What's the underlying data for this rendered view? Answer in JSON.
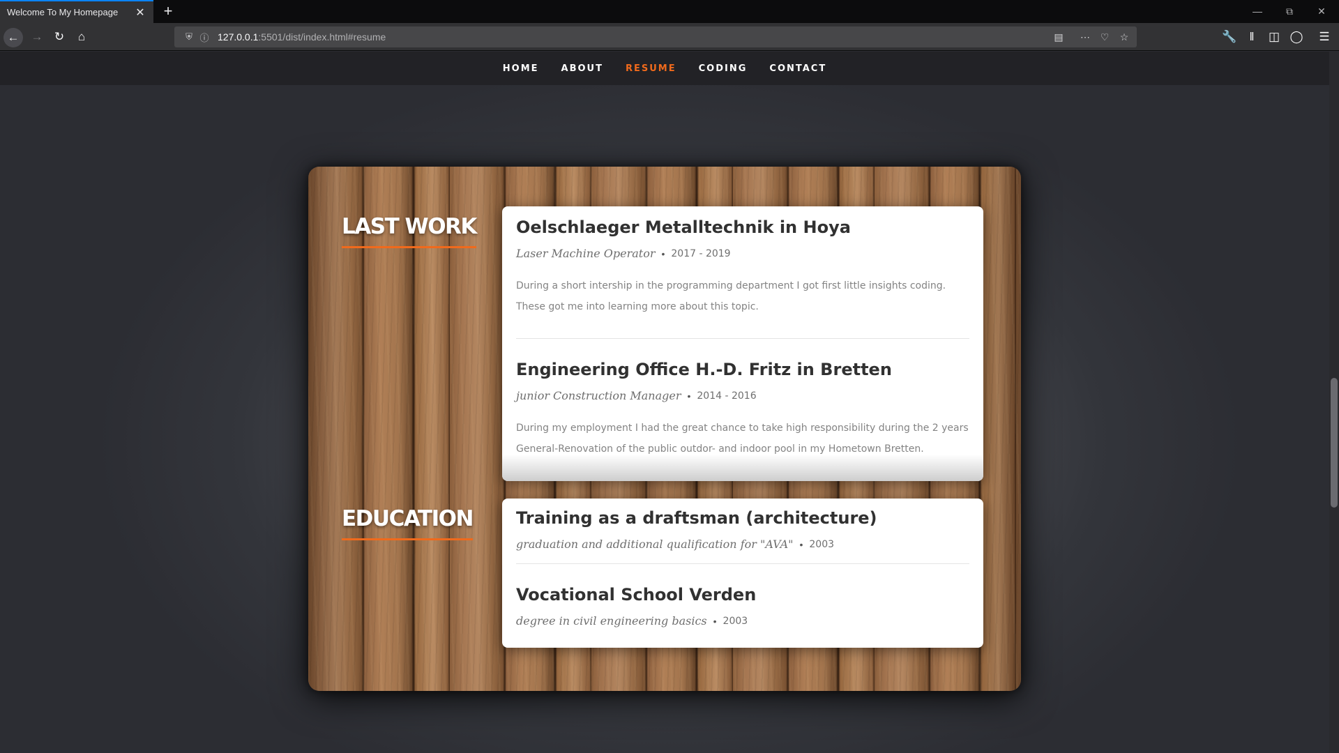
{
  "browser": {
    "tab_title": "Welcome To My Homepage",
    "tab_close": "✕",
    "new_tab": "+",
    "url_host": "127.0.0.1",
    "url_rest": ":5501/dist/index.html#resume"
  },
  "site_nav": {
    "items": [
      {
        "label": "HOME",
        "active": false
      },
      {
        "label": "ABOUT",
        "active": false
      },
      {
        "label": "RESUME",
        "active": true
      },
      {
        "label": "CODING",
        "active": false
      },
      {
        "label": "CONTACT",
        "active": false
      }
    ]
  },
  "resume": {
    "work_title": "LAST WORK",
    "work": [
      {
        "title": "Oelschlaeger Metalltechnik in Hoya",
        "role": "Laser Machine Operator",
        "bullet": "•",
        "date": "2017 - 2019",
        "desc_lines": [
          "During a short intership in the programming department I got first little insights coding.",
          "These got me into learning more about this topic."
        ]
      },
      {
        "title": "Engineering Office H.-D. Fritz in Bretten",
        "role": "junior Construction Manager",
        "bullet": "•",
        "date": "2014 - 2016",
        "desc_lines": [
          "During my employment I had the great chance to take high responsibility during the 2 years",
          "General-Renovation of the public outdor- and indoor pool in my Hometown Bretten."
        ]
      }
    ],
    "edu_title": "EDUCATION",
    "education": [
      {
        "title": "Training as a draftsman (architecture)",
        "role": "graduation and additional qualification for \"AVA\"",
        "bullet": "•",
        "date": "2003"
      },
      {
        "title": "Vocational School Verden",
        "role": "degree in civil engineering basics",
        "bullet": "•",
        "date": "2003"
      }
    ]
  },
  "colors": {
    "accent": "#f06a1c",
    "nav_bg": "#222226",
    "card_bg": "#ffffff"
  }
}
